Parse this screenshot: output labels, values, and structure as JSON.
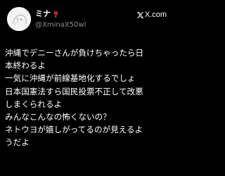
{
  "author": {
    "display_name": "ミナ",
    "name_emoji_icon": "rose-icon",
    "handle": "@XminaX50wl",
    "avatar_icon": "avatar-image"
  },
  "brand": {
    "logo_icon": "x-logo-icon",
    "label": "X.com"
  },
  "post": {
    "lines": [
      "沖縄でデニーさんが負けちゃったら日",
      "本終わるよ",
      "一気に沖縄が前線基地化するでしょ",
      "日本国憲法すら国民投票不正して改悪",
      "しまくられるよ",
      "みんなこんなの怖くないの？",
      "ネトウヨが嬉しがってるのが見えるよ",
      "うだよ"
    ]
  },
  "colors": {
    "background": "#000000",
    "text": "#ffffff",
    "handle": "#8a8d91",
    "rose": "#d1203a"
  }
}
